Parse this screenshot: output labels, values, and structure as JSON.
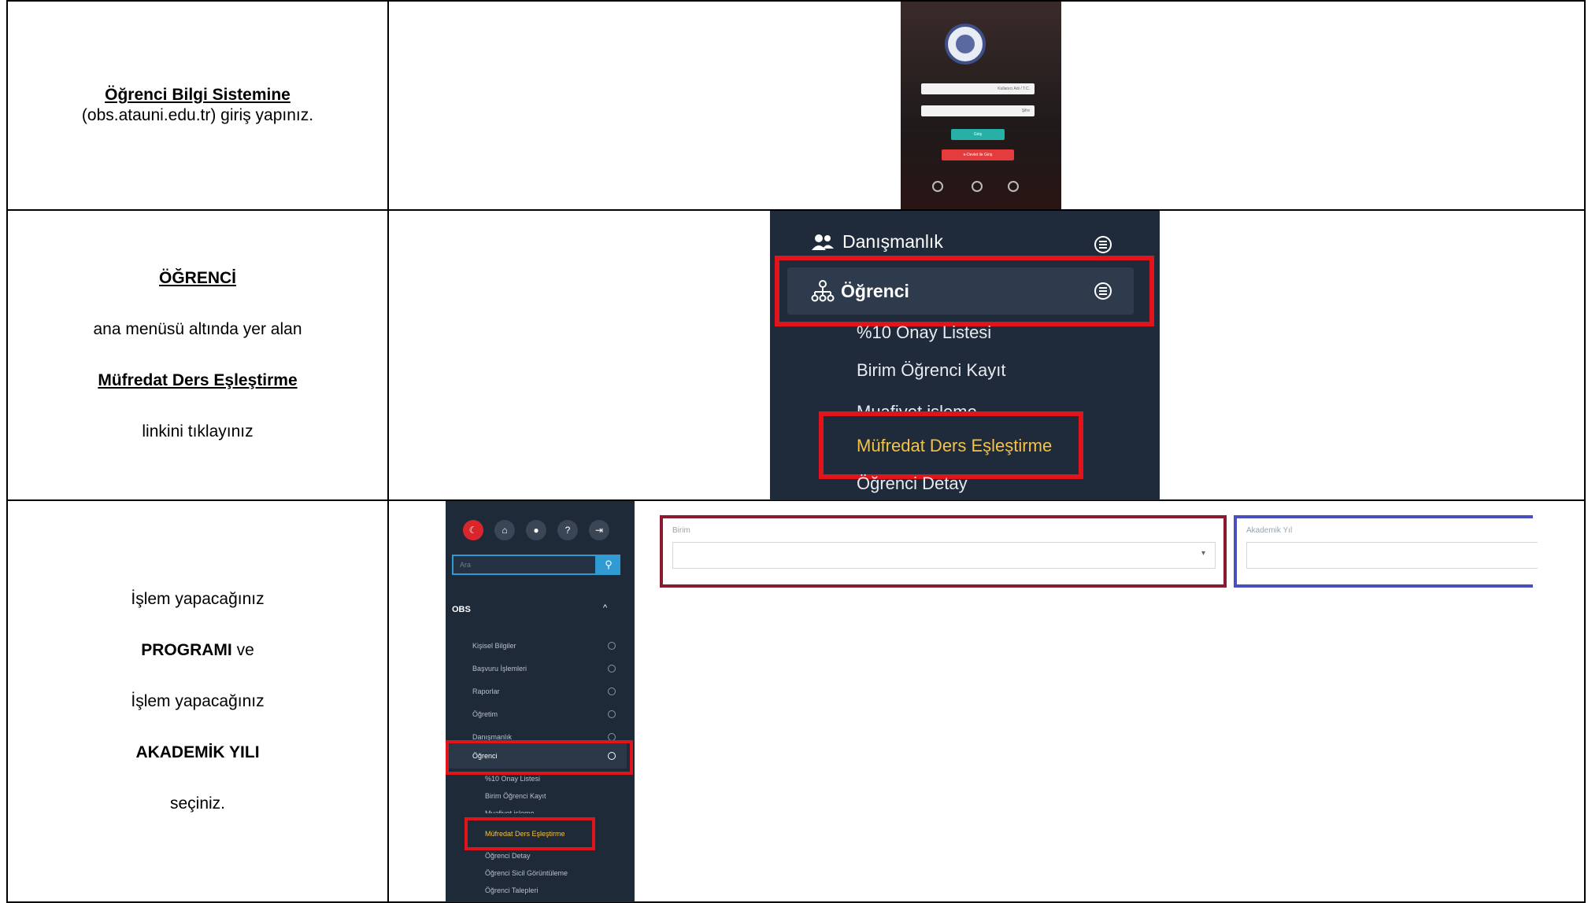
{
  "row1": {
    "title": "Öğrenci Bilgi Sistemine",
    "text": "(obs.atauni.edu.tr) giriş yapınız.",
    "phone": {
      "username_placeholder": "Kullanıcı Adı / T.C.",
      "password_placeholder": "Şifre",
      "login_button": "Giriş",
      "edevlet_button": "e-Devlet ile Giriş"
    }
  },
  "row2": {
    "heading": "ÖĞRENCİ",
    "line1": "ana menüsü altında yer alan",
    "link": "Müfredat Ders Eşleştirme",
    "line2": "linkini tıklayınız",
    "menu": {
      "item_danismanlik": "Danışmanlık",
      "item_ogrenci": "Öğrenci",
      "sub_items": [
        "%10 Onay Listesi",
        "Birim Öğrenci Kayıt",
        "Muafiyet işleme",
        "Müfredat Ders Eşleştirme",
        "Öğrenci Detay"
      ],
      "highlight_color": "#e1141c",
      "active_text_color": "#f5c242"
    }
  },
  "row3": {
    "l1": "İşlem yapacağınız",
    "l2_bold": "PROGRAMI",
    "l2_rest": " ve",
    "l3": "İşlem yapacağınız",
    "l4": "AKADEMİK YILI",
    "l5": "seçiniz.",
    "sidebar": {
      "search_placeholder": "Ara",
      "section": "OBS",
      "items": [
        "Kişisel Bilgiler",
        "Başvuru İşlemleri",
        "Raporlar",
        "Öğretim",
        "Danışmanlık",
        "Öğrenci"
      ],
      "sub_items": [
        "%10 Onay Listesi",
        "Birim Öğrenci Kayıt",
        "Muafiyet işleme",
        "Müfredat Ders Eşleştirme",
        "Öğrenci Detay",
        "Öğrenci Sicil Görüntüleme",
        "Öğrenci Talepleri"
      ]
    },
    "form": {
      "program_label": "Birim",
      "year_label": "Akademik Yıl",
      "program_box_color": "#8a1b2e",
      "year_box_color": "#4a4fc0"
    }
  }
}
